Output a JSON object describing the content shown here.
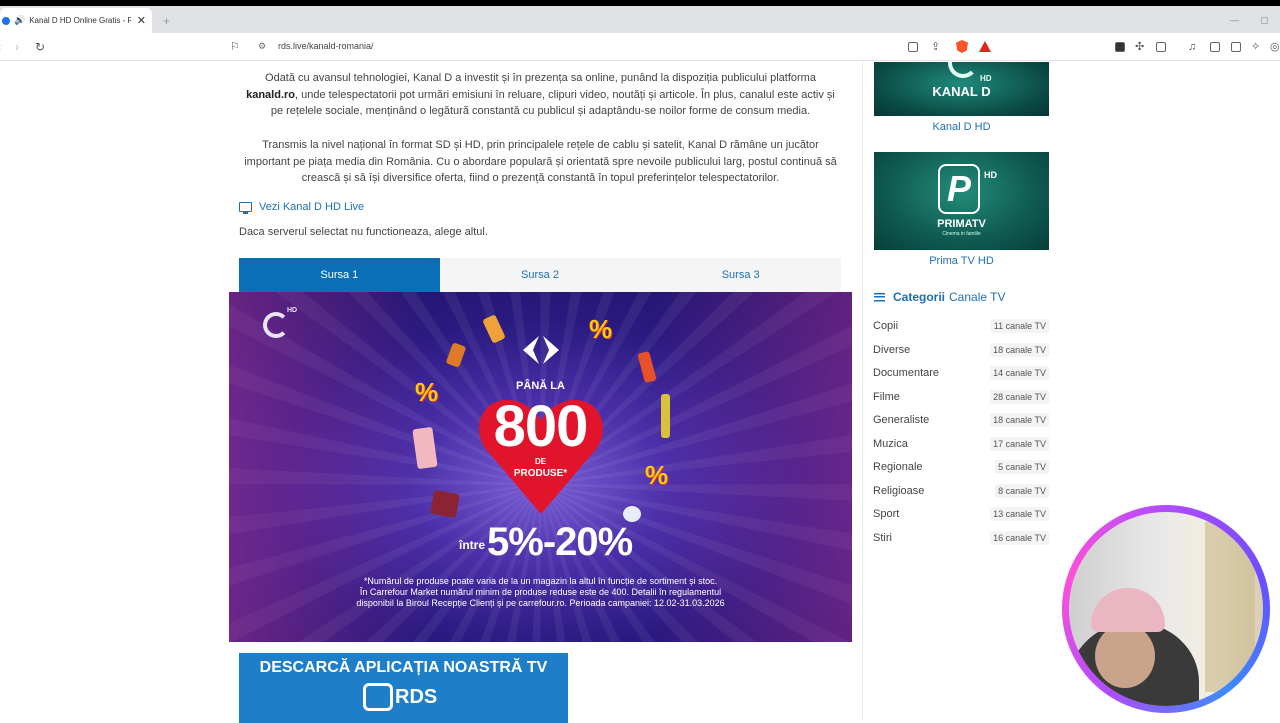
{
  "browser": {
    "tab_title": "Kanal D HD Online Gratis - RD",
    "tab_close": "✕",
    "new_tab": "+",
    "url": "rds.live/kanald-romania/"
  },
  "content": {
    "para1_a": "Odată cu avansul tehnologiei, Kanal D a investit și în prezența sa online, punând la dispoziția publicului platforma ",
    "para1_b": "kanald.ro",
    "para1_c": ", unde telespectatorii pot urmări emisiuni în reluare, clipuri video, noutăți și articole. În plus, canalul este activ și pe rețelele sociale, menținând o legătură constantă cu publicul și adaptându-se noilor forme de consum media.",
    "para2": "Transmis la nivel național în format SD și HD, prin principalele rețele de cablu și satelit, Kanal D rămâne un jucător important pe piața media din România. Cu o abordare populară și orientată spre nevoile publicului larg, postul continuă să crească și să își diversifice oferta, fiind o prezență constantă în topul preferințelor telespectatorilor.",
    "live_link": "Vezi Kanal D HD Live",
    "server_hint": "Daca serverul selectat nu functioneaza, alege altul.",
    "sources": [
      "Sursa 1",
      "Sursa 2",
      "Sursa 3"
    ],
    "active_source": 0
  },
  "player_ad": {
    "pana_la": "PÂNĂ LA",
    "big": "800",
    "de": "DE",
    "produse": "PRODUSE*",
    "intre": "între",
    "range": "5%-20%",
    "fine_1": "*Numărul de produse poate varia de la un magazin la altul în funcție de sortiment și stoc.",
    "fine_2": "În Carrefour Market numărul minim de produse reduse este de 400. Detalii în regulamentul",
    "fine_3": "disponibil la Biroul Recepție Clienți și pe carrefour.ro. Perioada campaniei: 12.02-31.03.2026",
    "channel_badge": "HD"
  },
  "app_banner": {
    "title": "DESCARCĂ APLICAȚIA NOASTRĂ TV",
    "brand": "RDS"
  },
  "sidebar": {
    "kanald_logo": "KANAL D",
    "kanald_hd": "HD",
    "kanald_caption": "Kanal D HD",
    "prima_logo": "PRIMATV",
    "prima_letter": "P",
    "prima_hd": "HD",
    "prima_sub": "Cinema in familie",
    "prima_caption": "Prima TV HD",
    "categories_bold": "Categorii",
    "categories_rest": "Canale TV",
    "categories": [
      {
        "name": "Copii",
        "count": "11 canale TV"
      },
      {
        "name": "Diverse",
        "count": "18 canale TV"
      },
      {
        "name": "Documentare",
        "count": "14 canale TV"
      },
      {
        "name": "Filme",
        "count": "28 canale TV"
      },
      {
        "name": "Generaliste",
        "count": "18 canale TV"
      },
      {
        "name": "Muzica",
        "count": "17 canale TV"
      },
      {
        "name": "Regionale",
        "count": "5 canale TV"
      },
      {
        "name": "Religioase",
        "count": "8 canale TV"
      },
      {
        "name": "Sport",
        "count": "13 canale TV"
      },
      {
        "name": "Stiri",
        "count": "16 canale TV"
      }
    ]
  },
  "colors": {
    "accent": "#0a6fb5",
    "link": "#1d6fb8",
    "banner": "#1e7fc8"
  }
}
